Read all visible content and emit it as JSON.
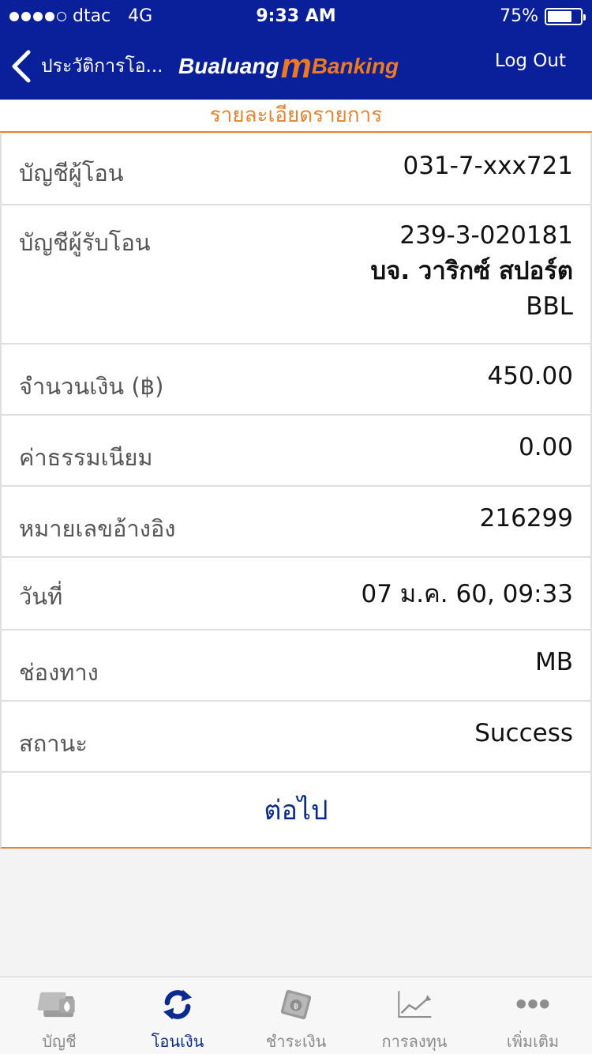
{
  "status_bar": {
    "carrier": "dtac",
    "network": "4G",
    "time": "9:33 AM",
    "battery_percent": "75%",
    "battery_level": 0.75,
    "signal_dots_filled": 4
  },
  "nav": {
    "back_label": "ประวัติการโอ...",
    "logo_part1": "Bualuang",
    "logo_m": "m",
    "logo_part2": "Banking",
    "logout_label": "Log Out"
  },
  "section_title": "รายละเอียดรายการ",
  "details": {
    "from_account": {
      "label": "บัญชีผู้โอน",
      "value": "031-7-xxx721"
    },
    "to_account": {
      "label": "บัญชีผู้รับโอน",
      "account_no": "239-3-020181",
      "name": "บจ. วาริกซ์ สปอร์ต",
      "bank": "BBL"
    },
    "amount": {
      "label": "จำนวนเงิน (฿)",
      "value": "450.00"
    },
    "fee": {
      "label": "ค่าธรรมเนียม",
      "value": "0.00"
    },
    "reference": {
      "label": "หมายเลขอ้างอิง",
      "value": "216299"
    },
    "date": {
      "label": "วันที่",
      "value": "07 ม.ค. 60, 09:33"
    },
    "channel": {
      "label": "ช่องทาง",
      "value": "MB"
    },
    "status": {
      "label": "สถานะ",
      "value": "Success"
    }
  },
  "next_label": "ต่อไป",
  "tabbar": {
    "accounts": "บัญชี",
    "transfer": "โอนเงิน",
    "pay": "ชำระเงิน",
    "invest": "การลงทุน",
    "more": "เพิ่มเติม"
  },
  "colors": {
    "header_blue": "#0a1f9a",
    "accent_orange": "#e8822b",
    "active_tab_blue": "#0a2b8f"
  }
}
